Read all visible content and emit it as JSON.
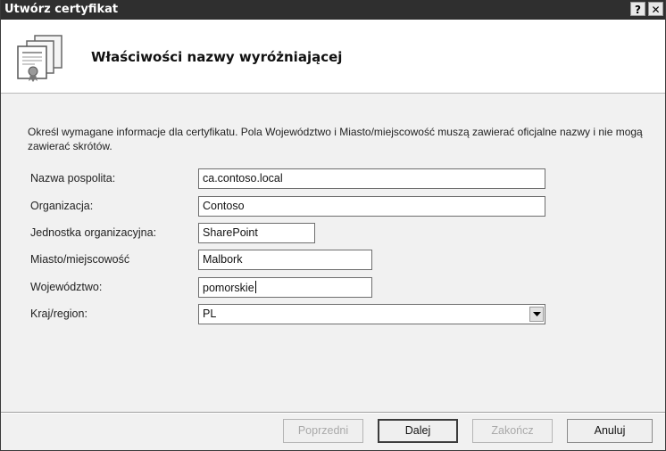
{
  "window": {
    "title": "Utwórz certyfikat",
    "help_glyph": "?",
    "close_glyph": "✕"
  },
  "header": {
    "title": "Właściwości nazwy wyróżniającej",
    "icon": "certificate-icon"
  },
  "description": "Określ wymagane informacje dla certyfikatu. Pola Województwo i Miasto/miejscowość muszą zawierać oficjalne nazwy i nie mogą zawierać skrótów.",
  "fields": {
    "common_name": {
      "label": "Nazwa pospolita:",
      "value": "ca.contoso.local"
    },
    "organization": {
      "label": "Organizacja:",
      "value": "Contoso"
    },
    "org_unit": {
      "label": "Jednostka organizacyjna:",
      "value": "SharePoint"
    },
    "city": {
      "label": "Miasto/miejscowość",
      "value": "Malbork"
    },
    "state": {
      "label": "Województwo:",
      "value": "pomorskie"
    },
    "country": {
      "label": "Kraj/region:",
      "value": "PL"
    }
  },
  "buttons": {
    "back": "Poprzedni",
    "next": "Dalej",
    "finish": "Zakończ",
    "cancel": "Anuluj"
  }
}
